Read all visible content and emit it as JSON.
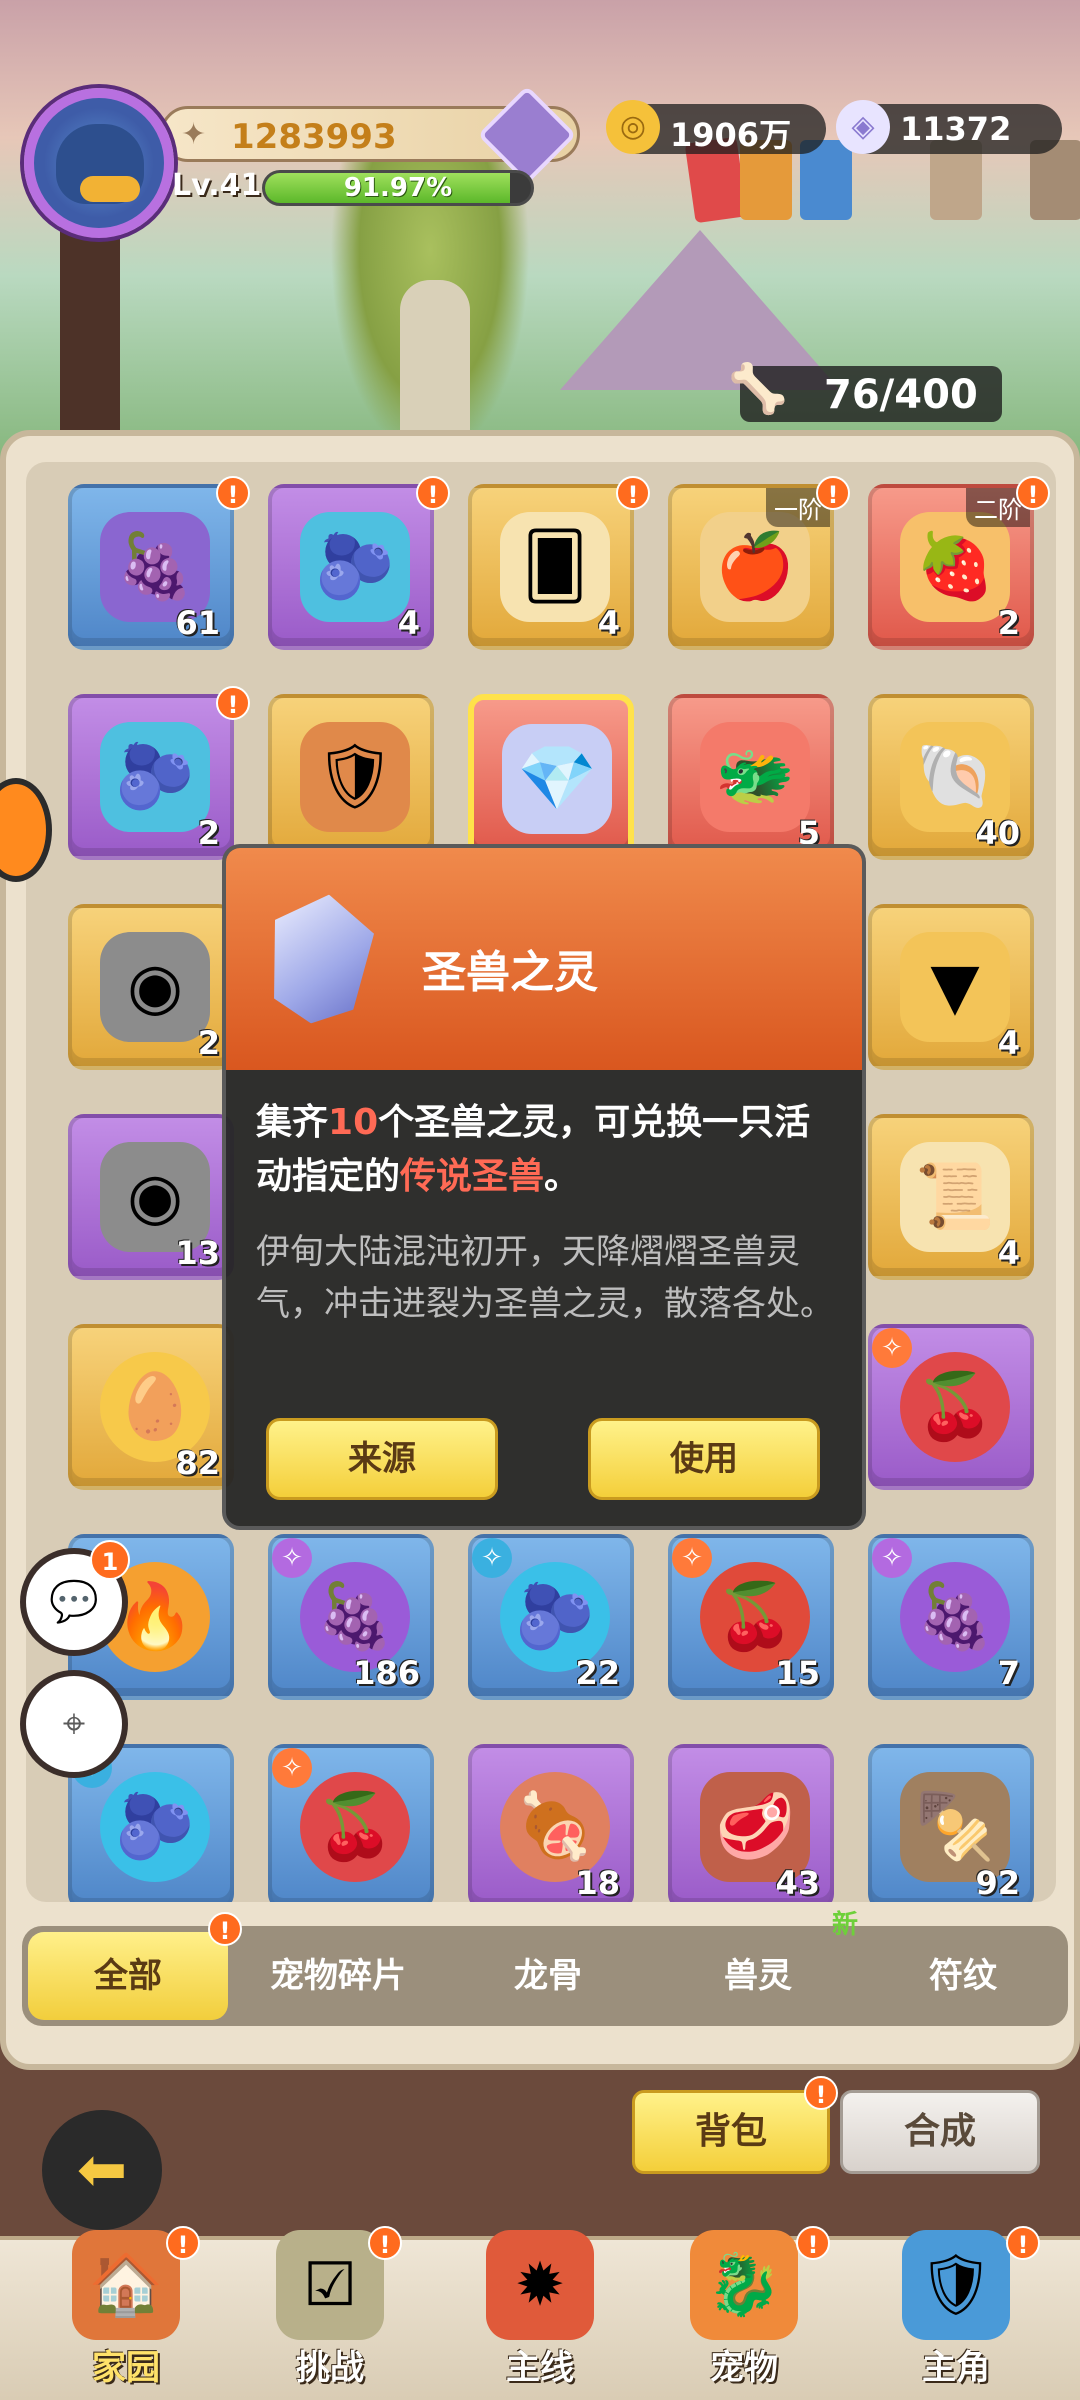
{
  "hud": {
    "power": "1283993",
    "level": "Lv.41",
    "exp_percent": 91.97,
    "exp_text": "91.97%",
    "gold": "1906万",
    "shells": "11372",
    "bones": "76/400"
  },
  "items_row1": [
    {
      "count": "61",
      "tag": ""
    },
    {
      "count": "4",
      "tag": ""
    },
    {
      "count": "4",
      "tag": ""
    },
    {
      "count": "",
      "tag": "一阶"
    },
    {
      "count": "2",
      "tag": "二阶"
    }
  ],
  "items_row2": [
    {
      "count": "2"
    },
    {
      "count": ""
    },
    {
      "count": ""
    },
    {
      "count": "5"
    },
    {
      "count": "40"
    }
  ],
  "items_row3": [
    {
      "count": "2"
    },
    {
      "count": "4"
    }
  ],
  "items_row4": [
    {
      "count": "13"
    },
    {
      "count": "4"
    }
  ],
  "items_row5": [
    {
      "count": "82"
    },
    {
      "count": ""
    }
  ],
  "items_row6": [
    {
      "count": ""
    },
    {
      "count": "186"
    },
    {
      "count": "22"
    },
    {
      "count": "15"
    },
    {
      "count": "7"
    }
  ],
  "items_row7": [
    {
      "count": ""
    },
    {
      "count": ""
    },
    {
      "count": "18"
    },
    {
      "count": "43"
    },
    {
      "count": "92"
    }
  ],
  "popup": {
    "title": "圣兽之灵",
    "desc_a": "集齐",
    "desc_num": "10",
    "desc_b": "个圣兽之灵，可兑换一只活动指定的",
    "desc_hl": "传说圣兽",
    "desc_c": "。",
    "lore": "伊甸大陆混沌初开，天降熠熠圣兽灵气，冲击进裂为圣兽之灵，散落各处。",
    "btn_source": "来源",
    "btn_use": "使用"
  },
  "tabs": [
    "全部",
    "宠物碎片",
    "龙骨",
    "兽灵",
    "符纹"
  ],
  "new_tag": "新",
  "chat_badge": "1",
  "bottom": {
    "bag": "背包",
    "craft": "合成"
  },
  "nav": [
    "家园",
    "挑战",
    "主线",
    "宠物",
    "主角"
  ],
  "colors": {
    "accent_yellow": "#f4cf3a",
    "alert_orange": "#ff6b1e",
    "highlight_red": "#ff6a55"
  }
}
